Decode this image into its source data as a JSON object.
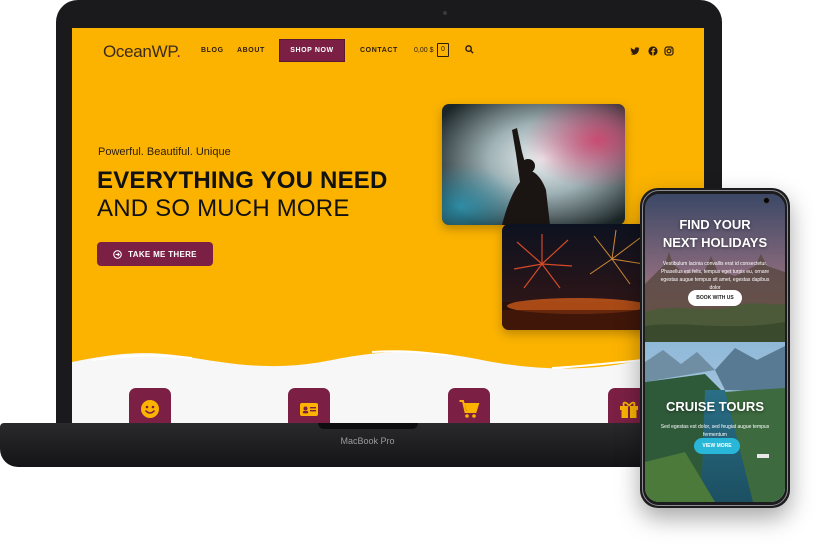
{
  "laptop": {
    "model_label": "MacBook Pro",
    "website": {
      "logo": "OceanWP",
      "logo_dot": ".",
      "nav": {
        "blog": "BLOG",
        "about": "ABOUT",
        "shop": "SHOP NOW",
        "contact": "CONTACT",
        "cart_total": "0,00 $",
        "cart_count": "0"
      },
      "social_icons": [
        "twitter-icon",
        "facebook-icon",
        "instagram-icon"
      ],
      "hero": {
        "subtitle": "Powerful. Beautiful. Unique",
        "title_line1": "EVERYTHING YOU NEED",
        "title_line2": "AND SO MUCH MORE",
        "button_label": "TAKE ME THERE"
      },
      "features": [
        "smile-icon",
        "id-card-icon",
        "cart-icon",
        "gift-icon"
      ],
      "colors": {
        "primary": "#fbb300",
        "accent": "#7b2044",
        "text": "#111111"
      }
    }
  },
  "phone": {
    "section1": {
      "title_line1": "FIND YOUR",
      "title_line2": "NEXT HOLIDAYS",
      "text": "Vestibulum lacinia convallis erat id consectetur. Phasellus est felis, tempus eget turpis eu, ornare egestas augue tempus sit amet, egestas dapibus dolor",
      "button_label": "BOOK WITH US"
    },
    "section2": {
      "title": "CRUISE TOURS",
      "text": "Sed egestas est dolor, sed feugiat augue tempus fermentum",
      "button_label": "VIEW MORE"
    }
  }
}
